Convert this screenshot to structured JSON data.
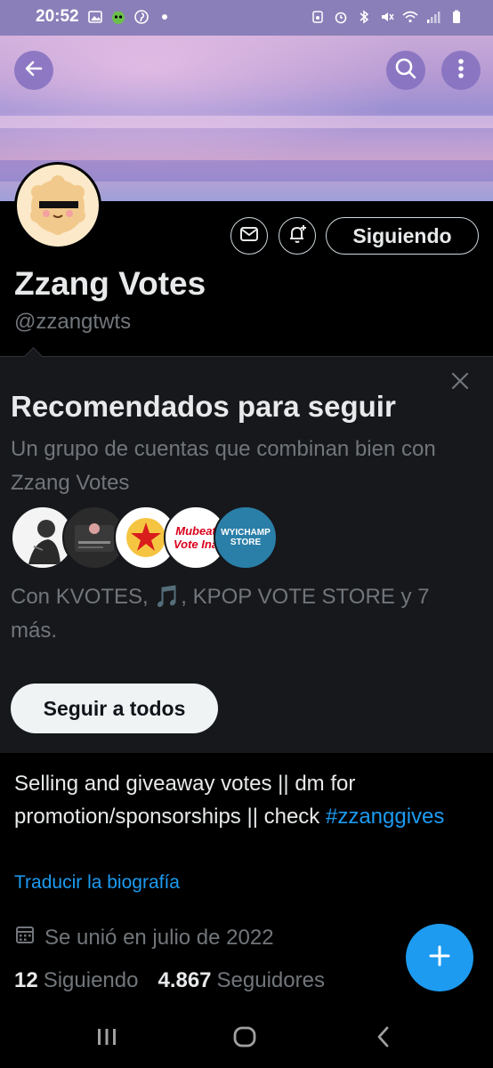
{
  "status_bar": {
    "time": "20:52"
  },
  "profile": {
    "name": "Zzang Votes",
    "handle": "@zzangtwts",
    "following_button": "Siguiendo"
  },
  "recommended": {
    "title": "Recomendados para seguir",
    "subtitle": "Un grupo de cuentas que combinan bien con Zzang Votes",
    "avatars": [
      {
        "label": ""
      },
      {
        "label": ""
      },
      {
        "label": ""
      },
      {
        "label": "Mubeat Vote Ina"
      },
      {
        "label": "WYICHAMP STORE"
      }
    ],
    "with_text": "Con KVOTES, 🎵, KPOP VOTE STORE y 7 más.",
    "follow_all_button": "Seguir a todos"
  },
  "bio": {
    "text": "Selling and giveaway votes || dm for promotion/sponsorships || check ",
    "hashtag": "#zzanggives",
    "translate_link": "Traducir la biografía"
  },
  "joined": {
    "text": "Se unió en julio de 2022"
  },
  "stats": {
    "following_count": "12",
    "following_label": "Siguiendo",
    "followers_count": "4.867",
    "followers_label": "Seguidores"
  },
  "colors": {
    "accent": "#1d9bf0",
    "status_bar": "#8a7fb8",
    "background": "#000000",
    "panel": "#16181c"
  },
  "icons": {
    "back": "arrow-left-icon",
    "search": "search-icon",
    "more": "more-vertical-icon",
    "message": "envelope-icon",
    "notify": "bell-plus-icon",
    "close": "close-icon",
    "calendar": "calendar-icon",
    "compose": "plus-icon"
  }
}
